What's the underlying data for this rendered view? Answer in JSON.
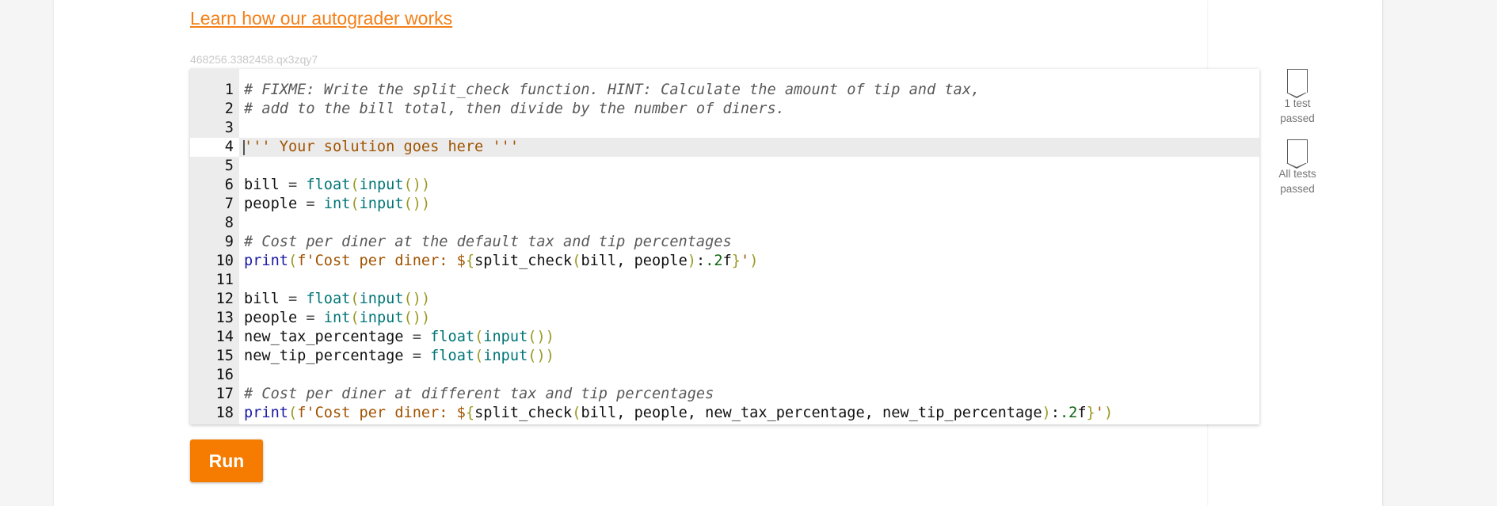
{
  "links": {
    "learn_autograder": "Learn how our autograder works"
  },
  "lab": {
    "id": "468256.3382458.qx3zqy7"
  },
  "editor": {
    "active_line": 4,
    "lines": [
      {
        "n": "1"
      },
      {
        "n": "2"
      },
      {
        "n": "3"
      },
      {
        "n": "4"
      },
      {
        "n": "5"
      },
      {
        "n": "6"
      },
      {
        "n": "7"
      },
      {
        "n": "8"
      },
      {
        "n": "9"
      },
      {
        "n": "10"
      },
      {
        "n": "11"
      },
      {
        "n": "12"
      },
      {
        "n": "13"
      },
      {
        "n": "14"
      },
      {
        "n": "15"
      },
      {
        "n": "16"
      },
      {
        "n": "17"
      },
      {
        "n": "18"
      }
    ],
    "code": [
      "# FIXME: Write the split_check function. HINT: Calculate the amount of tip and tax,",
      "# add to the bill total, then divide by the number of diners.",
      "",
      "''' Your solution goes here '''",
      "",
      "bill = float(input())",
      "people = int(input())",
      "",
      "# Cost per diner at the default tax and tip percentages",
      "print(f'Cost per diner: ${split_check(bill, people):.2f}')",
      "",
      "bill = float(input())",
      "people = int(input())",
      "new_tax_percentage = float(input())",
      "new_tip_percentage = float(input())",
      "",
      "# Cost per diner at different tax and tip percentages",
      "print(f'Cost per diner: ${split_check(bill, people, new_tax_percentage, new_tip_percentage):.2f}')"
    ]
  },
  "tests": [
    {
      "icon": "unfilled-flag-icon",
      "line1": "1 test",
      "line2": "passed"
    },
    {
      "icon": "unfilled-flag-icon",
      "line1": "All tests",
      "line2": "passed"
    }
  ],
  "buttons": {
    "run": "Run"
  },
  "colors": {
    "accent": "#f57c00",
    "link": "#f57f17"
  }
}
